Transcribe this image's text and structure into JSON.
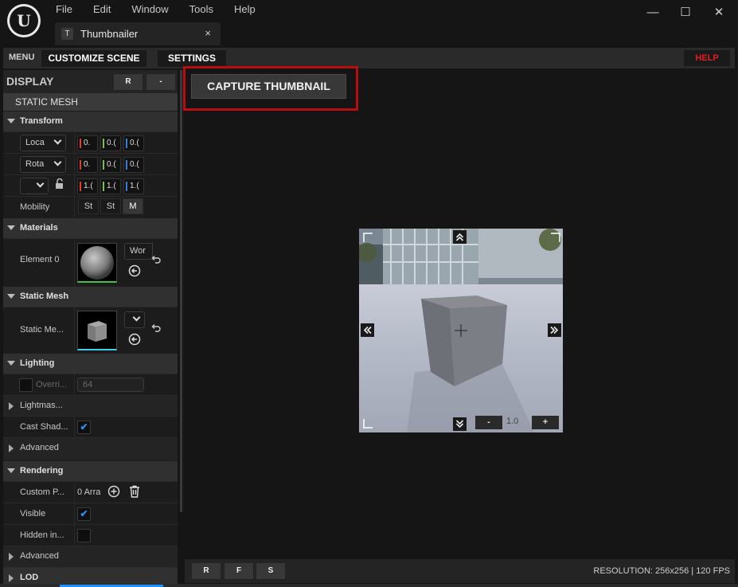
{
  "titlebar": {
    "logo_text": "U",
    "menu": [
      "File",
      "Edit",
      "Window",
      "Tools",
      "Help"
    ],
    "minimize": "—",
    "maximize": "☐",
    "close": "✕"
  },
  "tab": {
    "icon_text": "T",
    "label": "Thumbnailer",
    "close": "×"
  },
  "toolbar": {
    "menu_label": "MENU",
    "customize_scene": "CUSTOMIZE SCENE",
    "settings": "SETTINGS",
    "help": "HELP",
    "help_color": "#e21d1d"
  },
  "capture": {
    "label": "CAPTURE THUMBNAIL",
    "highlight_color": "#b80e0e"
  },
  "panel": {
    "title": "DISPLAY",
    "reset_btn": "R",
    "minus_btn": "-",
    "category": "STATIC MESH",
    "sections": {
      "transform": "Transform",
      "materials": "Materials",
      "static_mesh": "Static Mesh",
      "lighting": "Lighting",
      "rendering": "Rendering",
      "lod": "LOD"
    },
    "transform": {
      "location_dd": "Loca",
      "rotation_dd": "Rota",
      "scale_dd": "",
      "location": [
        "0.",
        "0.(",
        "0.("
      ],
      "rotation": [
        "0.",
        "0.(",
        "0.("
      ],
      "scale": [
        "1.(",
        "1.(",
        "1.("
      ],
      "mobility_label": "Mobility",
      "mobility_options": [
        "St",
        "St",
        "M"
      ]
    },
    "materials": {
      "element_label": "Element 0",
      "material_dd": "Wor"
    },
    "static_mesh": {
      "label": "Static Me..."
    },
    "lighting": {
      "override_label": "Overri...",
      "override_value": "64",
      "lightmass_label": "Lightmas...",
      "cast_shadow_label": "Cast Shad...",
      "cast_shadow_checked": "✔",
      "advanced_label": "Advanced"
    },
    "rendering": {
      "custom_label": "Custom P...",
      "custom_value": "0 Arra",
      "visible_label": "Visible",
      "visible_checked": "✔",
      "hidden_label": "Hidden in...",
      "advanced_label": "Advanced"
    },
    "axis_colors": {
      "x": "#e03b2b",
      "y": "#7bc23b",
      "z": "#3b7be0"
    }
  },
  "preview": {
    "zoom_minus": "-",
    "zoom_value": "1.0",
    "zoom_plus": "+",
    "nav_up": "⌃",
    "nav_down": "⌄",
    "nav_left": "«",
    "nav_right": "»"
  },
  "bottom": {
    "btn_r": "R",
    "btn_f": "F",
    "btn_s": "S",
    "status": "RESOLUTION: 256x256 | 120 FPS"
  }
}
